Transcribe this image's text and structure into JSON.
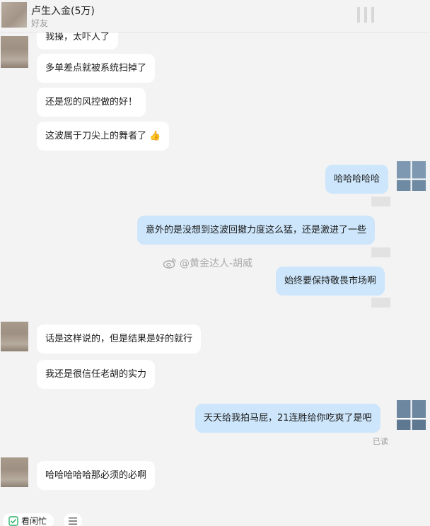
{
  "header": {
    "title": "卢生入金(5万)",
    "subtitle": "好友"
  },
  "messages": {
    "m1": "我操，太吓人了",
    "m2": "多单差点就被系统扫掉了",
    "m3": "还是您的风控做的好！",
    "m4": "这波属于刀尖上的舞者了",
    "m5": "哈哈哈哈哈",
    "m6": "意外的是没想到这波回撤力度这么猛，还是激进了一些",
    "m7": "始终要保持敬畏市场啊",
    "m8": "话是这样说的，但是结果是好的就行",
    "m9": "我还是很信任老胡的实力",
    "m10": "天天给我拍马屁，21连胜给你吃爽了是吧",
    "m11": "哈哈哈哈哈那必须的必啊"
  },
  "status": {
    "read": "已读"
  },
  "watermark": {
    "text": "@黄金达人-胡威",
    "icon": "weibo-icon"
  },
  "emoji": {
    "thumbs_up": "👍"
  },
  "bottom": {
    "kanxianmang_label": "看闲忙",
    "menu_icon": "hamburger-icon"
  },
  "colors": {
    "incoming_bubble": "#ffffff",
    "outgoing_bubble": "#cde6fb",
    "background": "#f3f3f3",
    "check_green": "#2fb36b"
  }
}
